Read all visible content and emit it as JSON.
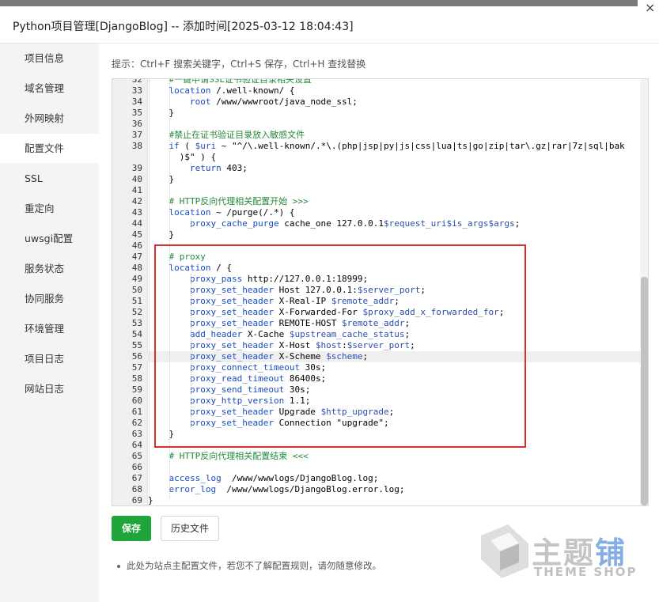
{
  "window": {
    "title": "Python项目管理[DjangoBlog] -- 添加时间[2025-03-12 18:04:43]",
    "close_glyph": "×"
  },
  "sidebar": {
    "items": [
      {
        "label": "项目信息",
        "active": false
      },
      {
        "label": "域名管理",
        "active": false
      },
      {
        "label": "外网映射",
        "active": false
      },
      {
        "label": "配置文件",
        "active": true
      },
      {
        "label": "SSL",
        "active": false
      },
      {
        "label": "重定向",
        "active": false
      },
      {
        "label": "uwsgi配置",
        "active": false
      },
      {
        "label": "服务状态",
        "active": false
      },
      {
        "label": "协同服务",
        "active": false
      },
      {
        "label": "环境管理",
        "active": false
      },
      {
        "label": "项目日志",
        "active": false
      },
      {
        "label": "网站日志",
        "active": false
      }
    ]
  },
  "editor": {
    "hint": "提示：Ctrl+F 搜索关键字，Ctrl+S 保存，Ctrl+H 查找替换",
    "current_line": "56",
    "lines": [
      {
        "n": "32",
        "html": "    <span class=\"c-com\">#一键申请SSL证书验证目录相关设置</span>"
      },
      {
        "n": "33",
        "html": "    <span class=\"c-key\">location</span> /.well-known/ {"
      },
      {
        "n": "34",
        "html": "        <span class=\"c-dir\">root</span> /www/wwwroot/java_node_ssl;"
      },
      {
        "n": "35",
        "html": "    }"
      },
      {
        "n": "36",
        "html": ""
      },
      {
        "n": "37",
        "html": "    <span class=\"c-com\">#禁止在证书验证目录放入敏感文件</span>"
      },
      {
        "n": "38",
        "html": "    <span class=\"c-key\">if</span> ( <span class=\"c-var\">$uri</span> ~ \"^/\\.well-known/.*\\.(php|jsp|py|js|css|lua|ts|go|zip|tar\\.gz|rar|7z|sql|bak"
      },
      {
        "n": "",
        "html": "      )$\" ) {"
      },
      {
        "n": "39",
        "html": "        <span class=\"c-key\">return</span> 403;"
      },
      {
        "n": "40",
        "html": "    }"
      },
      {
        "n": "41",
        "html": ""
      },
      {
        "n": "42",
        "html": "    <span class=\"c-com\"># HTTP反向代理相关配置开始 &gt;&gt;&gt;</span>"
      },
      {
        "n": "43",
        "html": "    <span class=\"c-key\">location</span> ~ /purge(/.*) {"
      },
      {
        "n": "44",
        "html": "        <span class=\"c-dir\">proxy_cache_purge</span> cache_one 127.0.0.1<span class=\"c-var\">$request_uri$is_args$args</span>;"
      },
      {
        "n": "45",
        "html": "    }"
      },
      {
        "n": "46",
        "html": ""
      },
      {
        "n": "47",
        "html": "    <span class=\"c-com\"># proxy</span>"
      },
      {
        "n": "48",
        "html": "    <span class=\"c-key\">location</span> / {"
      },
      {
        "n": "49",
        "html": "        <span class=\"c-dir\">proxy_pass</span> http://127.0.0.1:18999;"
      },
      {
        "n": "50",
        "html": "        <span class=\"c-dir\">proxy_set_header</span> Host 127.0.0.1:<span class=\"c-var\">$server_port</span>;"
      },
      {
        "n": "51",
        "html": "        <span class=\"c-dir\">proxy_set_header</span> X-Real-IP <span class=\"c-var\">$remote_addr</span>;"
      },
      {
        "n": "52",
        "html": "        <span class=\"c-dir\">proxy_set_header</span> X-Forwarded-For <span class=\"c-var\">$proxy_add_x_forwarded_for</span>;"
      },
      {
        "n": "53",
        "html": "        <span class=\"c-dir\">proxy_set_header</span> REMOTE-HOST <span class=\"c-var\">$remote_addr</span>;"
      },
      {
        "n": "54",
        "html": "        <span class=\"c-dir\">add_header</span> X-Cache <span class=\"c-var\">$upstream_cache_status</span>;"
      },
      {
        "n": "55",
        "html": "        <span class=\"c-dir\">proxy_set_header</span> X-Host <span class=\"c-var\">$host</span>:<span class=\"c-var\">$server_port</span>;"
      },
      {
        "n": "56",
        "html": "        <span class=\"c-dir\">proxy_set_header</span> X-Scheme <span class=\"c-var\">$scheme</span>;"
      },
      {
        "n": "57",
        "html": "        <span class=\"c-dir\">proxy_connect_timeout</span> 30s;"
      },
      {
        "n": "58",
        "html": "        <span class=\"c-dir\">proxy_read_timeout</span> 86400s;"
      },
      {
        "n": "59",
        "html": "        <span class=\"c-dir\">proxy_send_timeout</span> 30s;"
      },
      {
        "n": "60",
        "html": "        <span class=\"c-dir\">proxy_http_version</span> 1.1;"
      },
      {
        "n": "61",
        "html": "        <span class=\"c-dir\">proxy_set_header</span> Upgrade <span class=\"c-var\">$http_upgrade</span>;"
      },
      {
        "n": "62",
        "html": "        <span class=\"c-dir\">proxy_set_header</span> Connection \"upgrade\";"
      },
      {
        "n": "63",
        "html": "    }"
      },
      {
        "n": "64",
        "html": ""
      },
      {
        "n": "65",
        "html": "    <span class=\"c-com\"># HTTP反向代理相关配置结束 &lt;&lt;&lt;</span>"
      },
      {
        "n": "66",
        "html": ""
      },
      {
        "n": "67",
        "html": "    <span class=\"c-dir\">access_log</span>  /www/wwwlogs/DjangoBlog.log;"
      },
      {
        "n": "68",
        "html": "    <span class=\"c-dir\">error_log</span>  /www/wwwlogs/DjangoBlog.error.log;"
      },
      {
        "n": "69",
        "html": "}"
      }
    ]
  },
  "buttons": {
    "save": "保存",
    "history": "历史文件"
  },
  "note": "此处为站点主配置文件，若您不了解配置规则，请勿随意修改。",
  "watermark": {
    "text_cn_a": "主题",
    "text_cn_b": "铺",
    "text_en": "THEME SHOP"
  },
  "colors": {
    "accent_green": "#20a53a",
    "highlight_red": "#d9302f",
    "comment_green": "#238a38",
    "keyword_blue": "#1a4dbd"
  }
}
